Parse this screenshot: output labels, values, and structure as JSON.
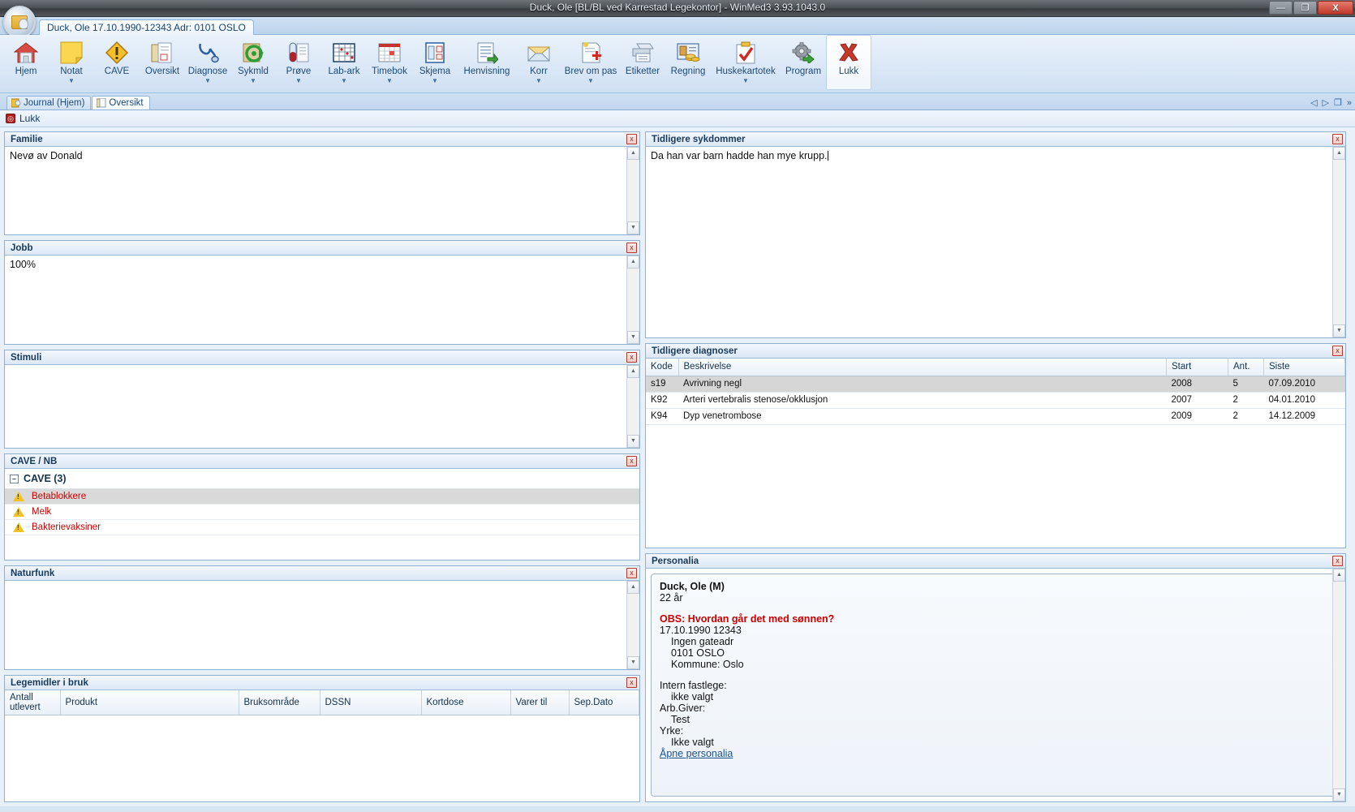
{
  "window": {
    "title": "Duck, Ole [BL/BL ved Karrestad Legekontor] - WinMed3 3.93.1043.0",
    "minimize_label": "—",
    "restore_label": "❐",
    "close_label": "X"
  },
  "patient_strip": {
    "tab_label": "Duck, Ole 17.10.1990-12343 Adr: 0101 OSLO"
  },
  "ribbon": {
    "items": [
      {
        "label": "Hjem",
        "icon": "home-icon",
        "arrow": false,
        "selected": false
      },
      {
        "label": "Notat",
        "icon": "note-icon",
        "arrow": true,
        "selected": false
      },
      {
        "label": "CAVE",
        "icon": "warning-icon",
        "arrow": false,
        "selected": false
      },
      {
        "label": "Oversikt",
        "icon": "overview-icon",
        "arrow": false,
        "selected": false
      },
      {
        "label": "Diagnose",
        "icon": "stethoscope-icon",
        "arrow": true,
        "selected": false
      },
      {
        "label": "Sykmld",
        "icon": "disability-icon",
        "arrow": true,
        "selected": false
      },
      {
        "label": "Prøve",
        "icon": "testtube-icon",
        "arrow": true,
        "selected": false
      },
      {
        "label": "Lab-ark",
        "icon": "labsheet-icon",
        "arrow": true,
        "selected": false
      },
      {
        "label": "Timebok",
        "icon": "calendar-icon",
        "arrow": true,
        "selected": false
      },
      {
        "label": "Skjema",
        "icon": "form-icon",
        "arrow": true,
        "selected": false
      },
      {
        "label": "Henvisning",
        "icon": "referral-icon",
        "arrow": false,
        "selected": false
      },
      {
        "label": "Korr",
        "icon": "mail-icon",
        "arrow": true,
        "selected": false
      },
      {
        "label": "Brev om pas",
        "icon": "letter-icon",
        "arrow": true,
        "selected": false
      },
      {
        "label": "Etiketter",
        "icon": "printer-icon",
        "arrow": false,
        "selected": false
      },
      {
        "label": "Regning",
        "icon": "invoice-icon",
        "arrow": false,
        "selected": false
      },
      {
        "label": "Huskekartotek",
        "icon": "clipboard-icon",
        "arrow": true,
        "selected": false
      },
      {
        "label": "Program",
        "icon": "gear-icon",
        "arrow": false,
        "selected": false
      },
      {
        "label": "Lukk",
        "icon": "close-x-icon",
        "arrow": false,
        "selected": true
      }
    ]
  },
  "view_tabs": {
    "tabs": [
      {
        "label": "Journal (Hjem)",
        "icon": "journal-icon",
        "active": false
      },
      {
        "label": "Oversikt",
        "icon": "overview-icon",
        "active": true
      }
    ],
    "nav": {
      "prev": "◁",
      "next": "▷",
      "windows": "❐",
      "more": "»"
    }
  },
  "close_row": {
    "label": "Lukk",
    "icon": "stop-icon"
  },
  "panels": {
    "familie": {
      "title": "Familie",
      "close": "x",
      "content": "Nevø av Donald"
    },
    "jobb": {
      "title": "Jobb",
      "close": "x",
      "content": "100%"
    },
    "stimuli": {
      "title": "Stimuli",
      "close": "x",
      "content": ""
    },
    "cave_nb": {
      "title": "CAVE / NB",
      "close": "x",
      "group_label": "CAVE (3)",
      "expander": "–",
      "items": [
        {
          "label": "Betablokkere",
          "selected": true
        },
        {
          "label": "Melk",
          "selected": false
        },
        {
          "label": "Bakterievaksiner",
          "selected": false
        }
      ]
    },
    "naturfunk": {
      "title": "Naturfunk",
      "close": "x",
      "content": ""
    },
    "legemidler": {
      "title": "Legemidler i bruk",
      "close": "x",
      "columns": [
        "Antall\nutlevert",
        "Produkt",
        "Bruksområde",
        "DSSN",
        "Kortdose",
        "Varer til",
        "Sep.Dato"
      ],
      "rows": []
    },
    "tidligere_sykdommer": {
      "title": "Tidligere sykdommer",
      "close": "x",
      "content": "Da han var barn hadde han mye krupp."
    },
    "tidligere_diagnoser": {
      "title": "Tidligere diagnoser",
      "close": "x",
      "columns": [
        "Kode",
        "Beskrivelse",
        "Start",
        "Ant.",
        "Siste"
      ],
      "rows": [
        {
          "kode": "s19",
          "beskrivelse": "Avrivning negl",
          "start": "2008",
          "ant": "5",
          "siste": "07.09.2010",
          "selected": true
        },
        {
          "kode": "K92",
          "beskrivelse": "Arteri vertebralis stenose/okklusjon",
          "start": "2007",
          "ant": "2",
          "siste": "04.01.2010",
          "selected": false
        },
        {
          "kode": "K94",
          "beskrivelse": "Dyp venetrombose",
          "start": "2009",
          "ant": "2",
          "siste": "14.12.2009",
          "selected": false
        }
      ]
    },
    "personalia": {
      "title": "Personalia",
      "close": "x",
      "name": "Duck, Ole (M)",
      "age": "22 år",
      "obs": "OBS: Hvordan går det med sønnen?",
      "birth_id": "17.10.1990 12343",
      "street": "Ingen gateadr",
      "postal": "0101 OSLO",
      "municipality": "Kommune: Oslo",
      "gp_label": "Intern fastlege:",
      "gp_value": "ikke valgt",
      "employer_label": "Arb.Giver:",
      "employer_value": "Test",
      "occupation_label": "Yrke:",
      "occupation_value": "Ikke valgt",
      "link": "Åpne personalia"
    }
  },
  "colors": {
    "accent": "#1b4a79",
    "alert_red": "#cc0000",
    "panel_border": "#8fb0d0",
    "selection_gray": "#d6d6d6"
  }
}
